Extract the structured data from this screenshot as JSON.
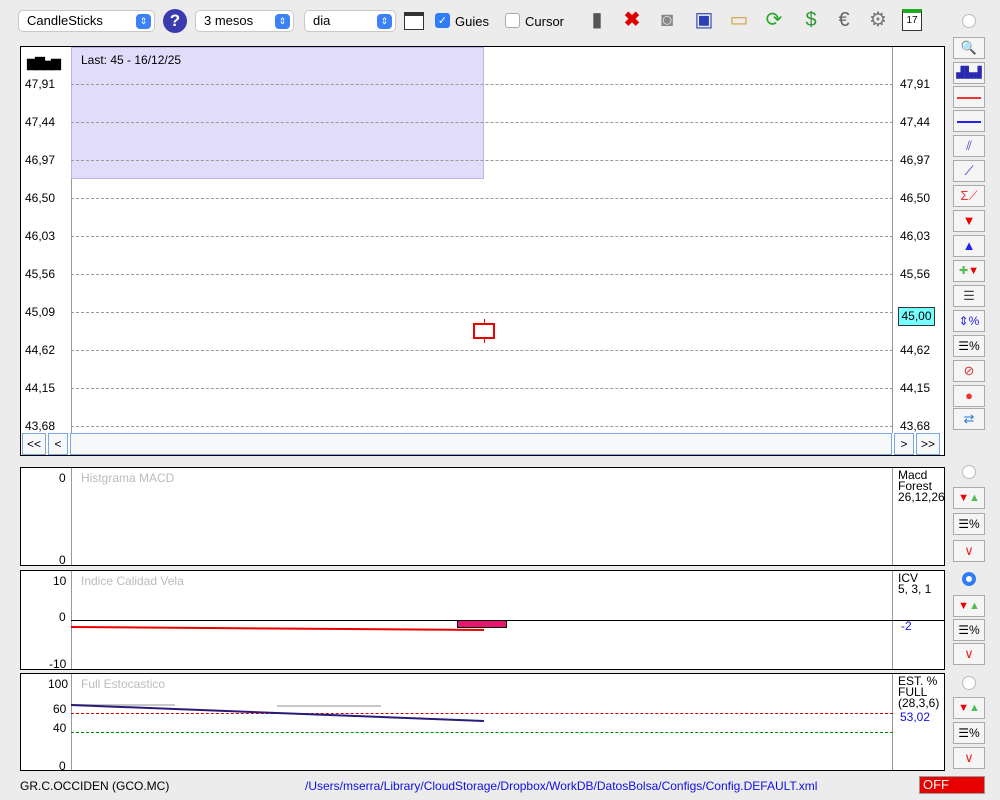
{
  "toolbar": {
    "chart_type": "CandleSticks",
    "period": "3 mesos",
    "interval": "dia",
    "guies_label": "Guies",
    "guies_checked": true,
    "cursor_label": "Cursor",
    "cursor_checked": false,
    "icons": [
      "help-icon",
      "chart-window-icon",
      "trash-icon",
      "delete-icon",
      "lamp-icon",
      "save-icon",
      "open-folder-icon",
      "refresh-icon",
      "dollar-refresh-icon",
      "euro-icon",
      "gear-icon",
      "calendar-icon"
    ],
    "calendar_day": "17"
  },
  "main": {
    "last_label": "Last: 45 - 16/12/25",
    "y_ticks": [
      "47,91",
      "47,44",
      "46,97",
      "46,50",
      "46,03",
      "45,56",
      "45,09",
      "44,62",
      "44,15",
      "43,68"
    ],
    "current_price": "45,00",
    "nav": [
      "<<",
      "<",
      ">",
      ">>"
    ],
    "candle": {
      "open": 45.09,
      "close": 44.9,
      "high": 45.15,
      "low": 44.86,
      "color": "#e00000"
    }
  },
  "macd": {
    "title": "Histgrama MACD",
    "y_ticks": [
      "0",
      "0"
    ],
    "label1": "Macd",
    "label2": "Forest",
    "params": "26,12,26"
  },
  "icv": {
    "title": "Indice Calidad Vela",
    "y_ticks": [
      "10",
      "0",
      "-10"
    ],
    "label": "ICV",
    "params": "5, 3, 1",
    "value": "-2"
  },
  "stoch": {
    "title": "Full Estocastico",
    "y_ticks": [
      "100",
      "60",
      "40",
      "0"
    ],
    "label1": "EST. %",
    "label2": "FULL",
    "params": "(28,3,6)",
    "value": "53,02"
  },
  "status": {
    "ticker": "GR.C.OCCIDEN (GCO.MC)",
    "path": "/Users/mserra/Library/CloudStorage/Dropbox/WorkDB/DatosBolsa/Configs/Config.DEFAULT.xml",
    "state": "OFF"
  },
  "colors": {
    "accent": "#2f7cf6",
    "overlay": "#e2dcfb",
    "off": "#e60000",
    "path": "#1010e0"
  }
}
